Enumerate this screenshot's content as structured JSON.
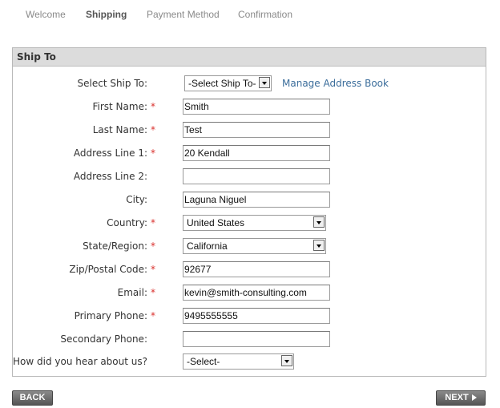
{
  "tabs": {
    "welcome": "Welcome",
    "shipping": "Shipping",
    "payment": "Payment Method",
    "confirmation": "Confirmation"
  },
  "panel": {
    "title": "Ship To"
  },
  "form": {
    "ship_to": {
      "label": "Select Ship To:",
      "value": "-Select Ship To-",
      "link": "Manage Address Book"
    },
    "first_name": {
      "label": "First Name:",
      "value": "Smith",
      "required": true
    },
    "last_name": {
      "label": "Last Name:",
      "value": "Test",
      "required": true
    },
    "address1": {
      "label": "Address Line 1:",
      "value": "20 Kendall",
      "required": true
    },
    "address2": {
      "label": "Address Line 2:",
      "value": ""
    },
    "city": {
      "label": "City:",
      "value": "Laguna Niguel"
    },
    "country": {
      "label": "Country:",
      "value": "United States",
      "required": true
    },
    "state": {
      "label": "State/Region:",
      "value": "California",
      "required": true
    },
    "zip": {
      "label": "Zip/Postal Code:",
      "value": "92677",
      "required": true
    },
    "email": {
      "label": "Email:",
      "value": "kevin@smith-consulting.com",
      "required": true
    },
    "primary_phone": {
      "label": "Primary Phone:",
      "value": "9495555555",
      "required": true
    },
    "secondary_phone": {
      "label": "Secondary Phone:",
      "value": ""
    },
    "hear_about": {
      "label": "How did you hear about us?",
      "value": "-Select-"
    }
  },
  "required_marker": "*",
  "buttons": {
    "back": "BACK",
    "next": "NEXT"
  },
  "colors": {
    "required": "#d9302c",
    "link": "#3b6d9b",
    "header_bg": "#dcdcdc"
  }
}
